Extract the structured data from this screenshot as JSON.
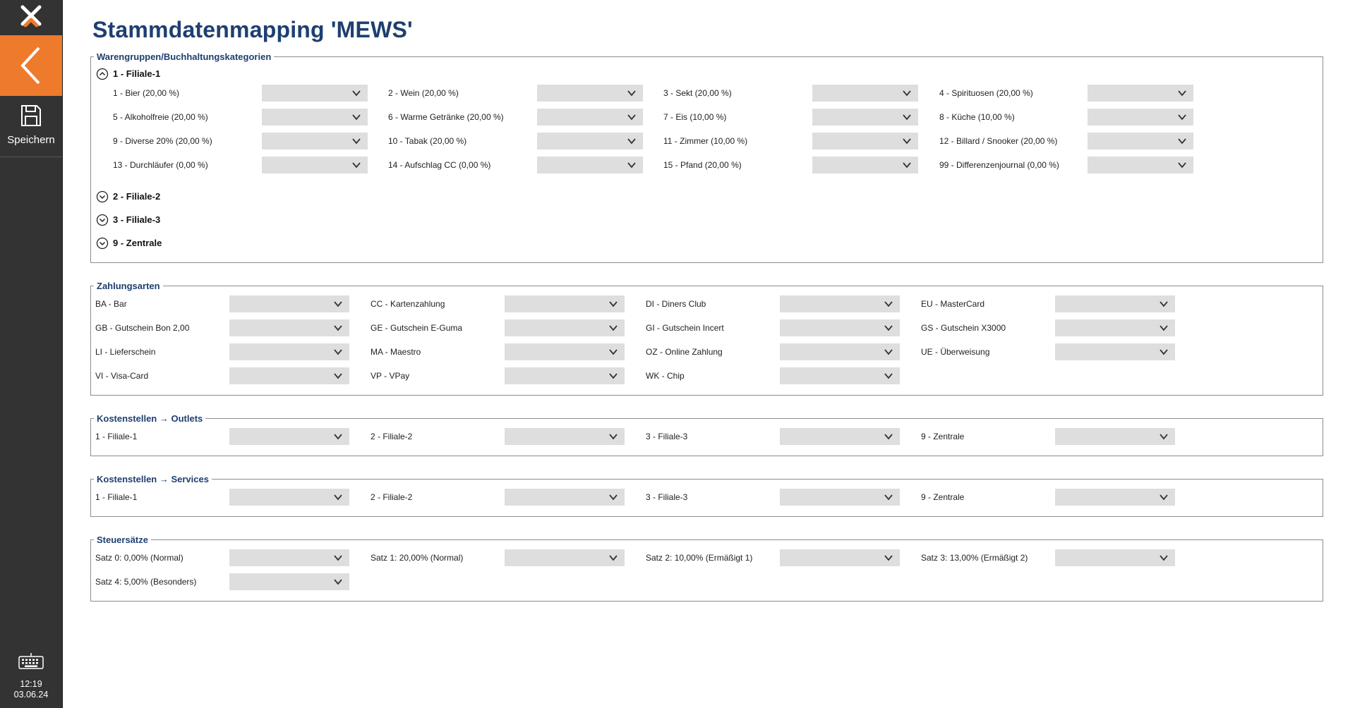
{
  "page_title": "Stammdatenmapping 'MEWS'",
  "sidebar": {
    "save_label": "Speichern",
    "time": "12:19",
    "date": "03.06.24"
  },
  "colors": {
    "accent": "#ee7a2c",
    "title": "#1e3f70",
    "sidebar": "#333333",
    "combo": "#dedede"
  },
  "groups": {
    "warengruppen": {
      "title": "Warengruppen/Buchhaltungskategorien",
      "branches": [
        "1 - Filiale-1",
        "2 - Filiale-2",
        "3 - Filiale-3",
        "9 - Zentrale"
      ],
      "items": [
        "1 - Bier (20,00 %)",
        "2 - Wein (20,00 %)",
        "3 - Sekt (20,00 %)",
        "4 - Spirituosen (20,00 %)",
        "5 - Alkoholfreie (20,00 %)",
        "6 - Warme Getränke (20,00 %)",
        "7 - Eis (10,00 %)",
        "8 - Küche (10,00 %)",
        "9 - Diverse 20% (20,00 %)",
        "10 - Tabak (20,00 %)",
        "11 - Zimmer (10,00 %)",
        "12 - Billard / Snooker (20,00 %)",
        "13 - Durchläufer (0,00 %)",
        "14 - Aufschlag CC (0,00 %)",
        "15 - Pfand (20,00 %)",
        "99 - Differenzenjournal (0,00 %)"
      ]
    },
    "zahlungsarten": {
      "title": "Zahlungsarten",
      "items": [
        "BA - Bar",
        "CC - Kartenzahlung",
        "DI - Diners Club",
        "EU - MasterCard",
        "GB - Gutschein Bon 2,00",
        "GE - Gutschein E-Guma",
        "GI - Gutschein Incert",
        "GS - Gutschein X3000",
        "LI - Lieferschein",
        "MA - Maestro",
        "OZ - Online Zahlung",
        "UE - Überweisung",
        "VI - Visa-Card",
        "VP - VPay",
        "WK - Chip"
      ]
    },
    "outlets": {
      "title": "Kostenstellen → Outlets",
      "items": [
        "1 - Filiale-1",
        "2 - Filiale-2",
        "3 - Filiale-3",
        "9 - Zentrale"
      ]
    },
    "services": {
      "title": "Kostenstellen → Services",
      "items": [
        "1 - Filiale-1",
        "2 - Filiale-2",
        "3 - Filiale-3",
        "9 - Zentrale"
      ]
    },
    "steuersaetze": {
      "title": "Steuersätze",
      "items": [
        "Satz 0: 0,00% (Normal)",
        "Satz 1: 20,00% (Normal)",
        "Satz 2: 10,00% (Ermäßigt 1)",
        "Satz 3: 13,00% (Ermäßigt 2)",
        "Satz 4: 5,00% (Besonders)"
      ]
    }
  }
}
